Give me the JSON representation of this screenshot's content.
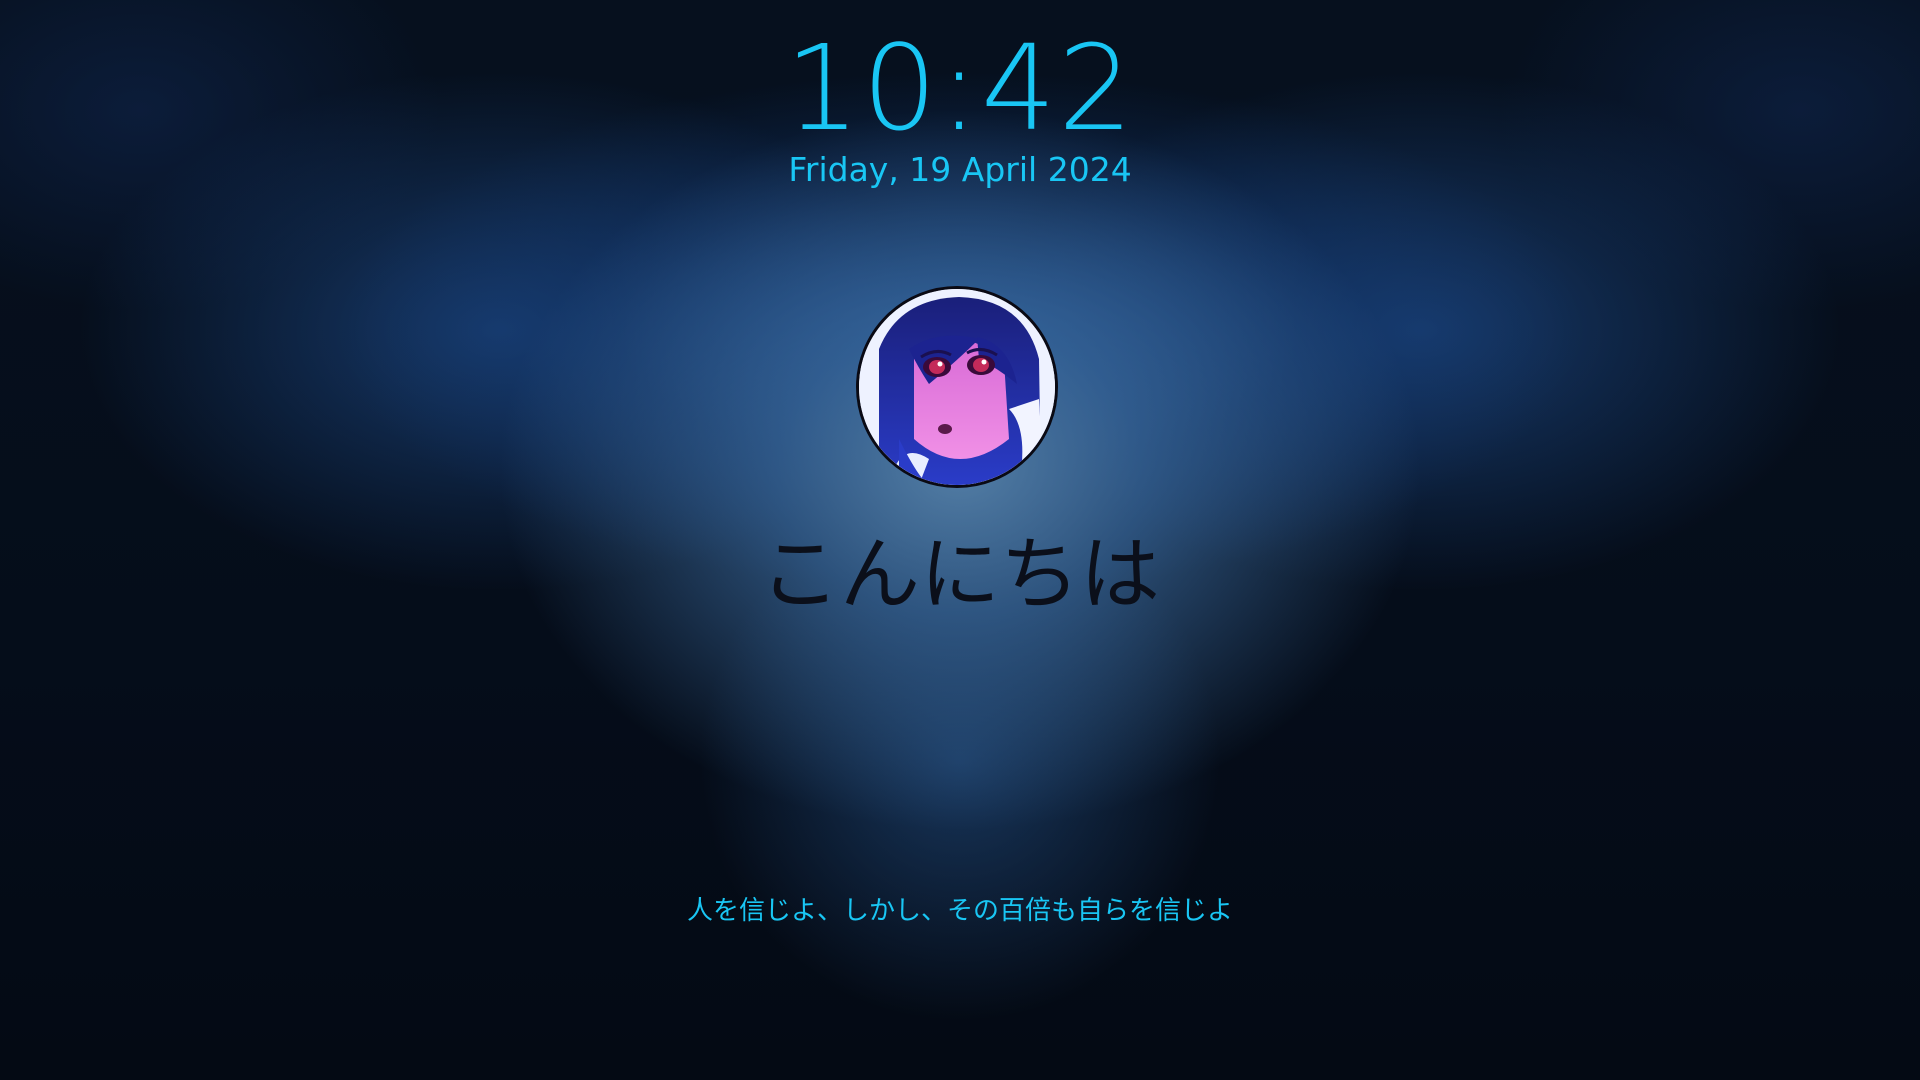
{
  "lock_screen": {
    "time": "10:42",
    "date": "Friday, 19 April 2024",
    "greeting": "こんにちは",
    "quote": "人を信じよ、しかし、その百倍も自らを信じよ",
    "avatar": "user-avatar-anime-portrait"
  },
  "colors": {
    "accent": "#19c6f4",
    "greeting_text": "#0b0f1a",
    "background_dark": "#040a14",
    "background_glow": "#5682aa"
  }
}
